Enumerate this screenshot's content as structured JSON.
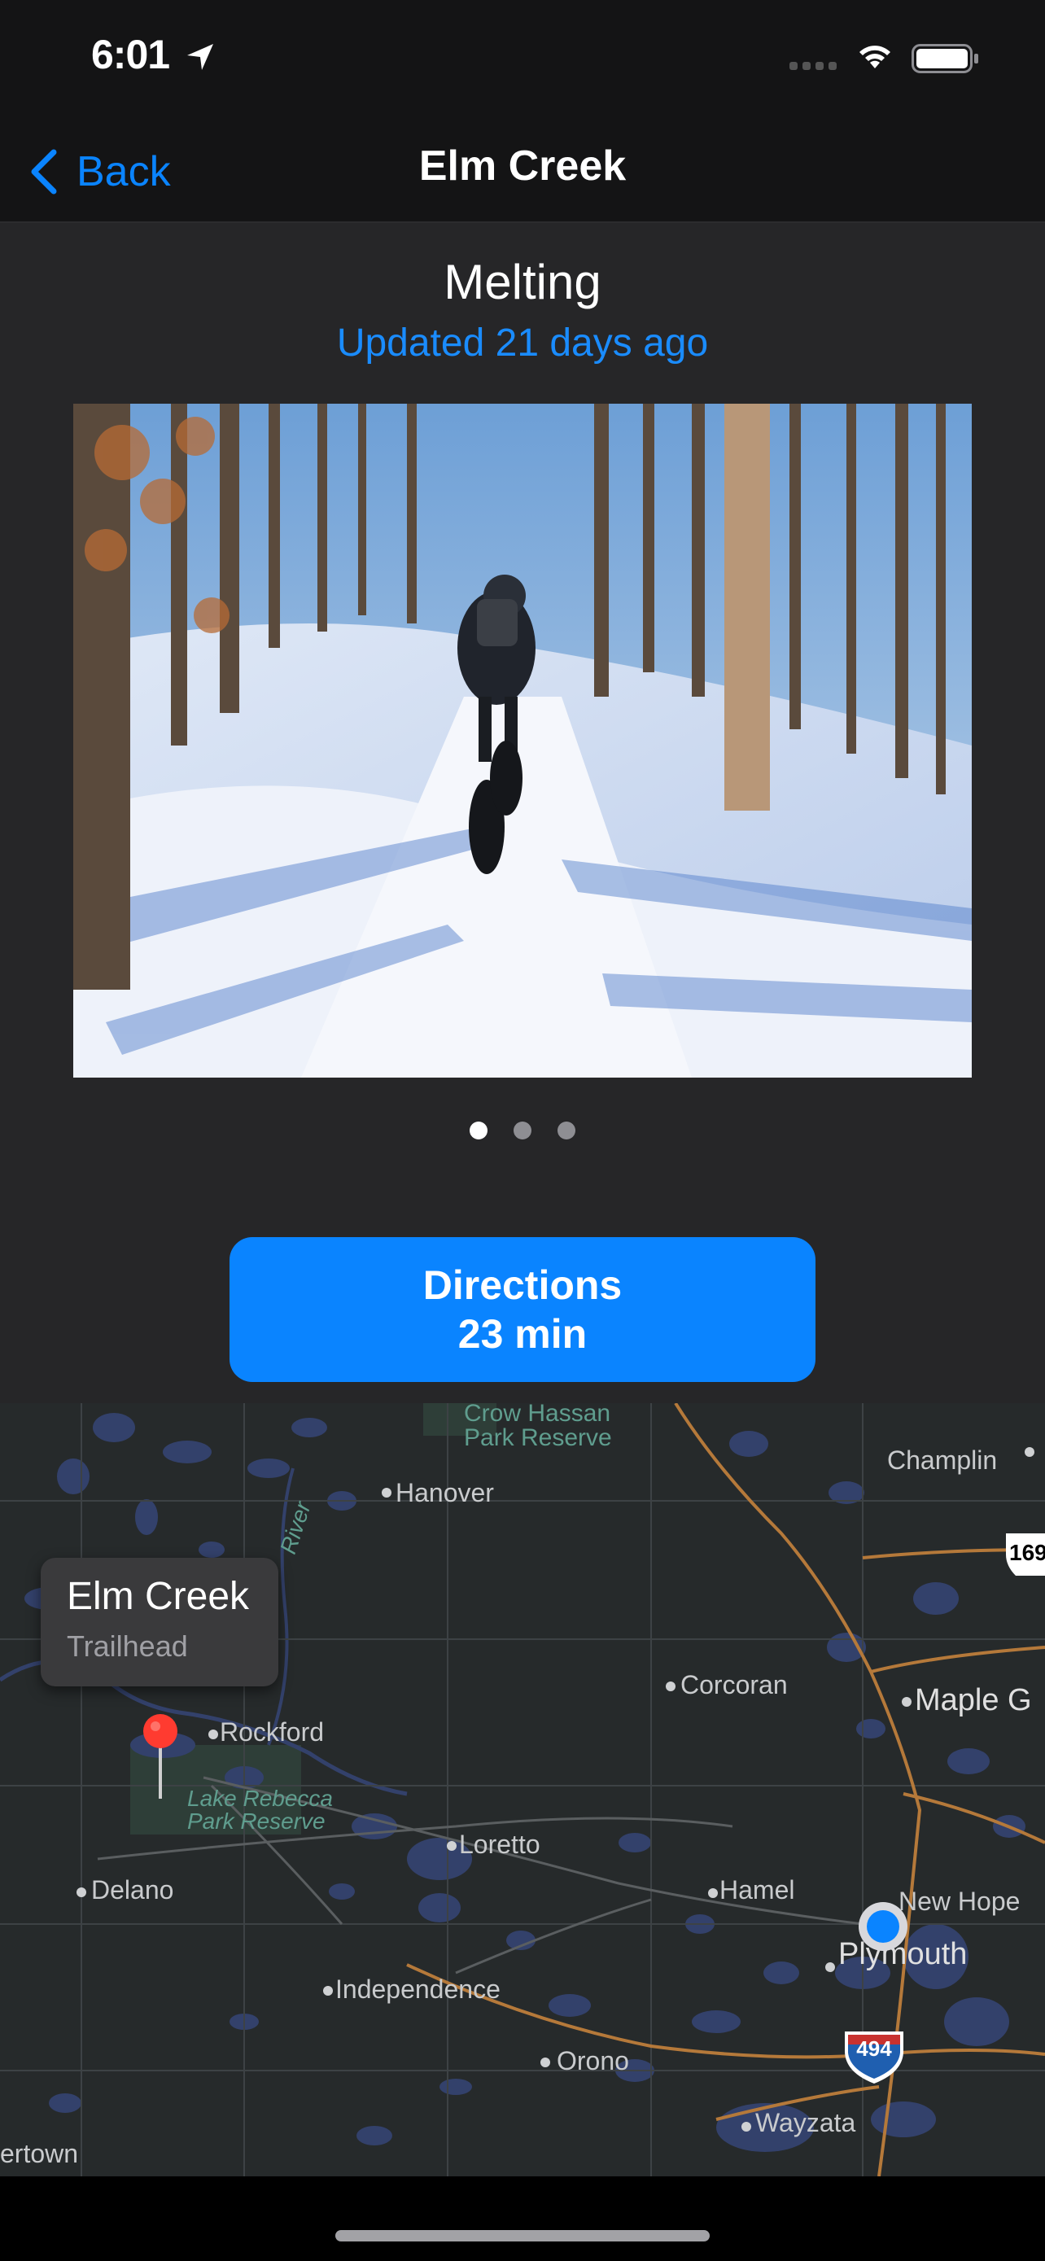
{
  "status_bar": {
    "time": "6:01"
  },
  "nav": {
    "back_label": "Back",
    "title": "Elm Creek"
  },
  "trail": {
    "condition": "Melting",
    "updated": "Updated 21 days ago",
    "photo_pages": 3,
    "current_page": 1
  },
  "directions": {
    "label": "Directions",
    "time": "23 min"
  },
  "map": {
    "callout_title": "Elm Creek",
    "callout_subtitle": "Trailhead",
    "places": {
      "crow_hassan_1": "Crow Hassan",
      "crow_hassan_2": "Park Reserve",
      "hanover": "Hanover",
      "champlin": "Champlin",
      "corcoran": "Corcoran",
      "maple_grove": "Maple G",
      "rockford": "Rockford",
      "lake_rebecca_1": "Lake Rebecca",
      "lake_rebecca_2": "Park Reserve",
      "loretto": "Loretto",
      "delano": "Delano",
      "hamel": "Hamel",
      "new_hope": "New Hope",
      "plymouth": "Plymouth",
      "independence": "Independence",
      "orono": "Orono",
      "wayzata": "Wayzata",
      "watertown": "ertown",
      "river": "River"
    },
    "shields": {
      "us169": "169",
      "i494": "494"
    },
    "colors": {
      "water": "#33416b",
      "highway": "#b5793a",
      "user": "#0a84ff",
      "pin": "#ff3b30"
    }
  }
}
